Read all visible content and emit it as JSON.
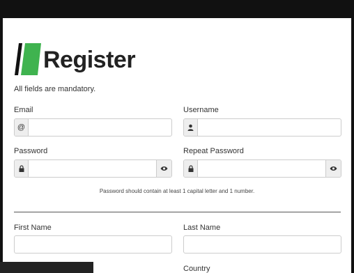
{
  "form": {
    "title": "Register",
    "subtitle": "All fields are mandatory.",
    "email_label": "Email",
    "email_icon": "@",
    "username_label": "Username",
    "password_label": "Password",
    "repeat_password_label": "Repeat Password",
    "password_hint": "Password should contain at least 1 capital letter and 1 number.",
    "first_name_label": "First Name",
    "last_name_label": "Last Name",
    "country_label": "Country"
  },
  "colors": {
    "logo_green": "#3fb34f",
    "logo_dark": "#111111"
  },
  "icons": {
    "email": "at-icon",
    "username": "user-icon",
    "password": "lock-icon",
    "show_password": "eye-icon"
  }
}
